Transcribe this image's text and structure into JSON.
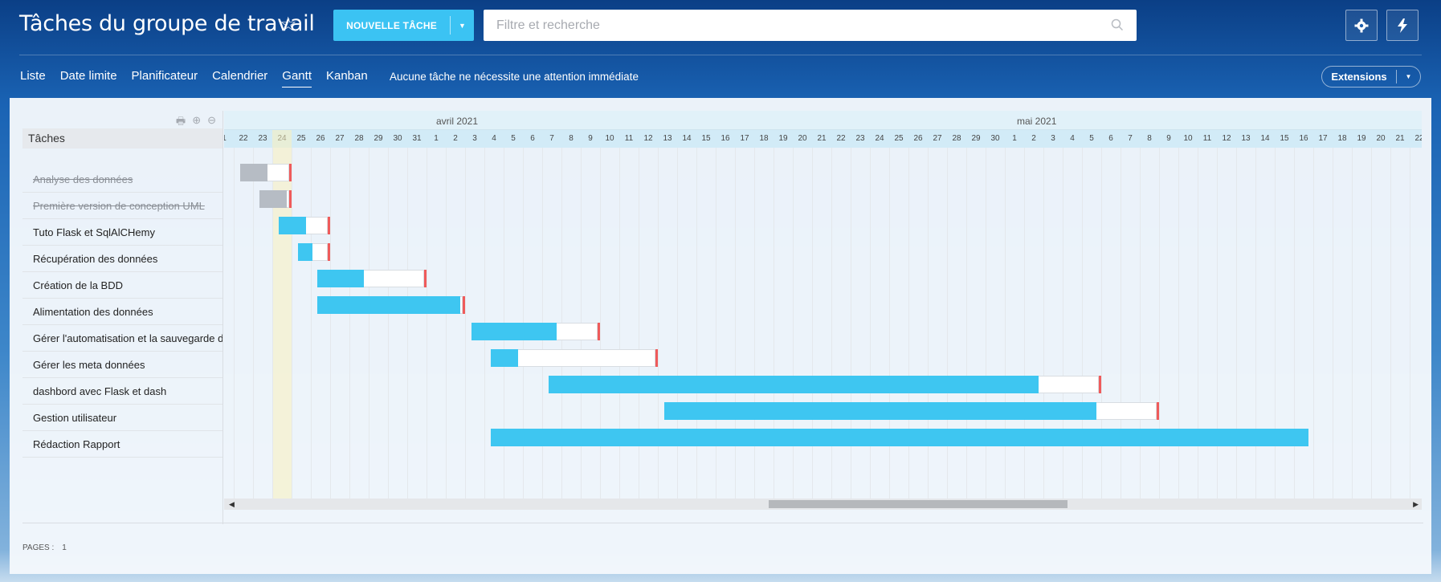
{
  "header": {
    "title": "Tâches du groupe de travail",
    "new_task_label": "NOUVELLE TÂCHE",
    "search_placeholder": "Filtre et recherche"
  },
  "nav": {
    "items": [
      "Liste",
      "Date limite",
      "Planificateur",
      "Calendrier",
      "Gantt",
      "Kanban"
    ],
    "active": "Gantt",
    "notice": "Aucune tâche ne nécessite une attention immédiate",
    "extensions_label": "Extensions"
  },
  "tasks_column_header": "Tâches",
  "months": [
    {
      "label": "avril 2021"
    },
    {
      "label": "mai 2021"
    }
  ],
  "day_labels": [
    "1",
    "22",
    "23",
    "24",
    "25",
    "26",
    "27",
    "28",
    "29",
    "30",
    "31",
    "1",
    "2",
    "3",
    "4",
    "5",
    "6",
    "7",
    "8",
    "9",
    "10",
    "11",
    "12",
    "13",
    "14",
    "15",
    "16",
    "17",
    "18",
    "19",
    "20",
    "21",
    "22",
    "23",
    "24",
    "25",
    "26",
    "27",
    "28",
    "29",
    "30",
    "1",
    "2",
    "3",
    "4",
    "5",
    "6",
    "7",
    "8",
    "9",
    "10",
    "11",
    "12",
    "13",
    "14",
    "15",
    "16",
    "17",
    "18",
    "19",
    "20",
    "21",
    "22"
  ],
  "today_day": "24",
  "tasks": [
    {
      "name": "Analyse des données",
      "completed": true,
      "start": "2021-03-22",
      "progress_end": "2021-03-23",
      "deadline": "2021-03-24"
    },
    {
      "name": "Première version de conception UML",
      "completed": true,
      "start": "2021-03-23",
      "progress_end": "2021-03-24",
      "deadline": "2021-03-24"
    },
    {
      "name": "Tuto Flask et SqlAlCHemy",
      "completed": false,
      "start": "2021-03-24",
      "progress_end": "2021-03-25",
      "deadline": "2021-03-26"
    },
    {
      "name": "Récupération des données",
      "completed": false,
      "start": "2021-03-25",
      "progress_end": "2021-03-25",
      "deadline": "2021-03-26"
    },
    {
      "name": "Création de la BDD",
      "completed": false,
      "start": "2021-03-26",
      "progress_end": "2021-03-28",
      "deadline": "2021-03-31"
    },
    {
      "name": "Alimentation des données",
      "completed": false,
      "start": "2021-03-26",
      "progress_end": "2021-04-02",
      "deadline": "2021-04-02"
    },
    {
      "name": "Gérer l'automatisation et la sauvegarde des données",
      "completed": false,
      "start": "2021-04-03",
      "progress_end": "2021-04-07",
      "deadline": "2021-04-09"
    },
    {
      "name": "Gérer les meta données",
      "completed": false,
      "start": "2021-04-04",
      "progress_end": "2021-04-05",
      "deadline": "2021-04-12"
    },
    {
      "name": "dashbord avec Flask et dash",
      "completed": false,
      "start": "2021-04-07",
      "progress_end": "2021-05-02",
      "deadline": "2021-05-05"
    },
    {
      "name": "Gestion utilisateur",
      "completed": false,
      "start": "2021-04-13",
      "progress_end": "2021-05-05",
      "deadline": "2021-05-08"
    },
    {
      "name": "Rédaction Rapport",
      "completed": false,
      "start": "2021-04-04",
      "progress_end": "2021-05-16",
      "deadline": null
    }
  ],
  "pagination": {
    "label": "PAGES :",
    "current": "1"
  }
}
